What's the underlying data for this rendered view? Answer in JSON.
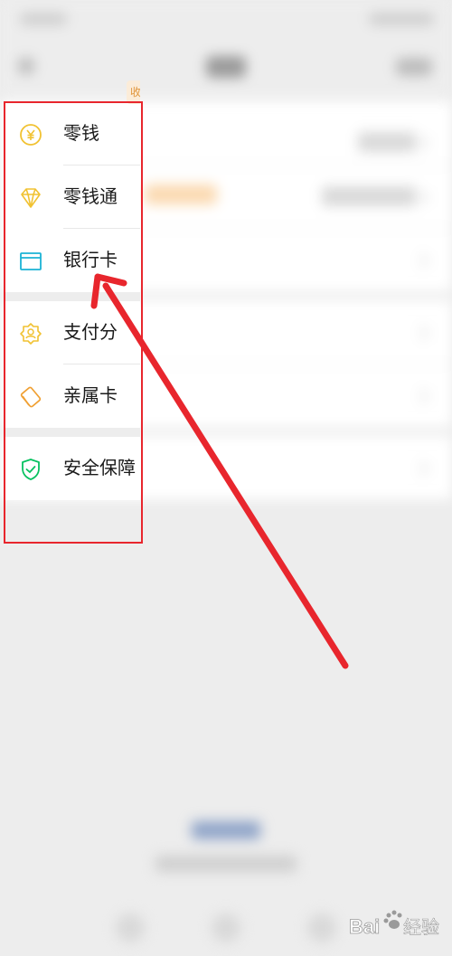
{
  "menu": {
    "groups": [
      {
        "items": [
          {
            "label": "零钱",
            "icon": "yuan-coin-icon"
          },
          {
            "label": "零钱通",
            "icon": "diamond-icon",
            "badge": "收"
          },
          {
            "label": "银行卡",
            "icon": "bank-card-icon"
          }
        ]
      },
      {
        "items": [
          {
            "label": "支付分",
            "icon": "badge-user-icon"
          },
          {
            "label": "亲属卡",
            "icon": "family-card-icon"
          }
        ]
      },
      {
        "items": [
          {
            "label": "安全保障",
            "icon": "shield-check-icon"
          }
        ]
      }
    ]
  },
  "annotation": {
    "color": "#e8262d"
  },
  "watermark": {
    "text": "Bai",
    "suffix": "经验"
  },
  "colors": {
    "yellow": "#f1c232",
    "cyan": "#1bb3d5",
    "orange": "#f0a033",
    "green": "#07c160"
  }
}
